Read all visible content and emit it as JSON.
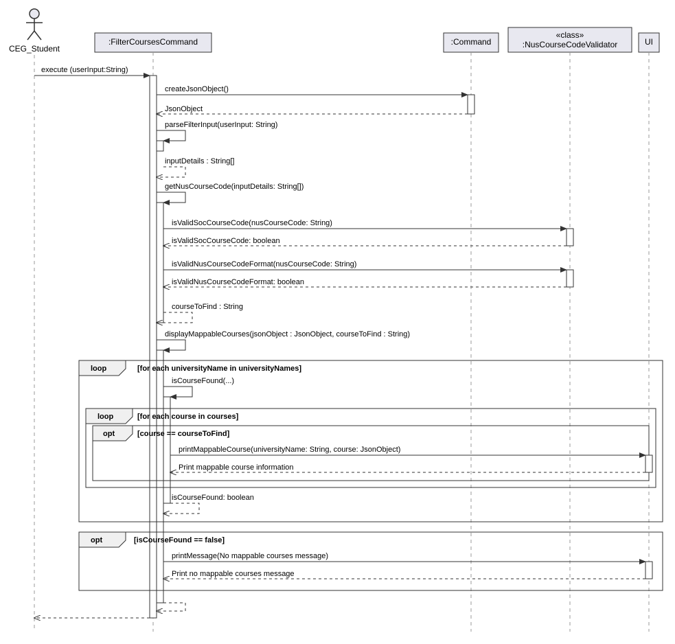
{
  "actor": {
    "name": "CEG_Student"
  },
  "participants": {
    "fcc": ":FilterCoursesCommand",
    "cmd": ":Command",
    "ncc": "«class»\n:NusCourseCodeValidator",
    "ui": "UI"
  },
  "messages": {
    "execute": "execute (userInput:String)",
    "createJson": "createJsonObject()",
    "jsonObjReturn": "JsonObject",
    "parseFilter": "parseFilterInput(userInput: String)",
    "inputDetails": "inputDetails : String[]",
    "getNusCode": "getNusCourseCode(inputDetails: String[])",
    "isValidSoc": "isValidSocCourseCode(nusCourseCode: String)",
    "isValidSocReturn": "isValidSocCourseCode: boolean",
    "isValidFmt": "isValidNusCourseCodeFormat(nusCourseCode: String)",
    "isValidFmtReturn": "isValidNusCourseCodeFormat: boolean",
    "courseToFind": "courseToFind : String",
    "displayMappable": "displayMappableCourses(jsonObject : JsonObject, courseToFind : String)",
    "isCourseFoundCall": "isCourseFound(...)",
    "printMappable": "printMappableCourse(universityName: String, course: JsonObject)",
    "printMappableReturn": "Print mappable course information",
    "isCourseFoundRet": "isCourseFound: boolean",
    "printNoMap": "printMessage(No mappable courses message)",
    "printNoMapReturn": "Print no mappable courses message"
  },
  "frames": {
    "loop1": {
      "label": "loop",
      "guard": "[for each universityName in universityNames]"
    },
    "loop2": {
      "label": "loop",
      "guard": "[for each course in courses]"
    },
    "opt1": {
      "label": "opt",
      "guard": "[course == courseToFind]"
    },
    "opt2": {
      "label": "opt",
      "guard": "[isCourseFound == false]"
    }
  }
}
